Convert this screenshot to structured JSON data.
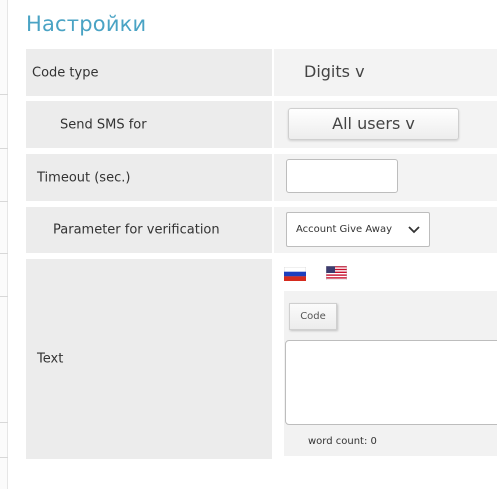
{
  "page": {
    "title": "Настройки"
  },
  "rows": {
    "code_type": {
      "label": "Code type",
      "value": "Digits v"
    },
    "send_sms": {
      "label": "Send SMS for",
      "value": "All users v"
    },
    "timeout": {
      "label": "Timeout (sec.)",
      "value": ""
    },
    "parameter": {
      "label": "Parameter for verification",
      "selected": "Account Give Away"
    },
    "text": {
      "label": "Text",
      "languages": [
        "ru-flag-icon",
        "us-flag-icon"
      ],
      "code_button": "Code",
      "textarea_value": "",
      "word_count": "word count: 0"
    }
  },
  "colors": {
    "title": "#4aa3c4",
    "label_bg": "#ececec",
    "value_bg": "#f3f3f3"
  }
}
